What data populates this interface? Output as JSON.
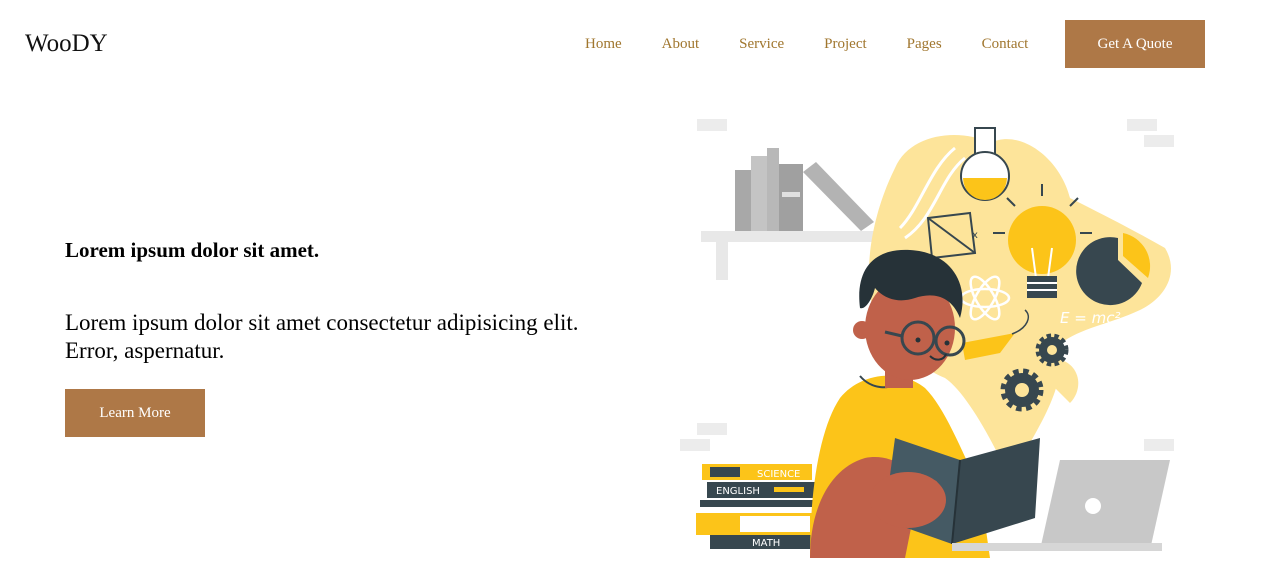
{
  "brand": {
    "name": "WooDY"
  },
  "nav": {
    "items": [
      {
        "label": "Home"
      },
      {
        "label": "About"
      },
      {
        "label": "Service"
      },
      {
        "label": "Project"
      },
      {
        "label": "Pages"
      },
      {
        "label": "Contact"
      }
    ],
    "cta_label": "Get A Quote"
  },
  "hero": {
    "heading": "Lorem ipsum dolor sit amet.",
    "text": "Lorem ipsum dolor sit amet consectetur adipisicing elit. Error, aspernatur.",
    "button_label": "Learn More"
  },
  "illustration": {
    "books": {
      "science": "SCIENCE",
      "english": "ENGLISH",
      "math": "MATH"
    },
    "formula": "E = mc²"
  },
  "colors": {
    "accent": "#ae7847",
    "nav_link": "#a0762e",
    "illustration_yellow": "#fcc419",
    "illustration_teal": "#37474f"
  }
}
